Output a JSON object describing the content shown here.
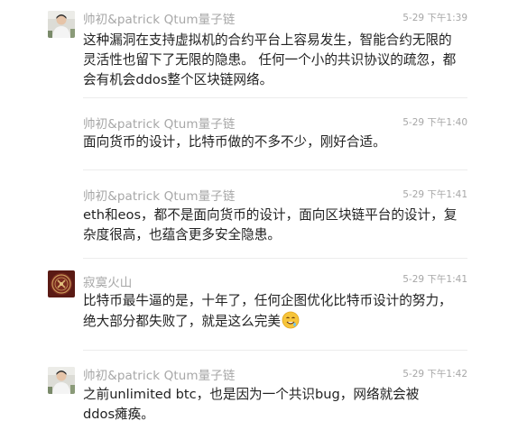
{
  "messages": [
    {
      "sender": "帅初&patrick Qtum量子链",
      "time": "5-29 下午1:39",
      "avatar": "person-photo",
      "lines": [
        "这种漏洞在支持虚拟机的合约平台上容易发生，智能合约无限的",
        "灵活性也留下了无限的隐患。 任何一个小的共识协议的疏忽，都",
        "会有机会ddos整个区块链网络。"
      ]
    },
    {
      "sender": "帅初&patrick Qtum量子链",
      "time": "5-29 下午1:40",
      "avatar": "none",
      "lines": [
        "面向货币的设计，比特币做的不多不少，刚好合适。"
      ]
    },
    {
      "sender": "帅初&patrick Qtum量子链",
      "time": "5-29 下午1:41",
      "avatar": "none",
      "lines": [
        "eth和eos，都不是面向货币的设计，面向区块链平台的设计，复",
        "杂度很高，也蕴含更多安全隐患。"
      ]
    },
    {
      "sender": "寂寞火山",
      "time": "5-29 下午1:41",
      "avatar": "emblem",
      "lines": [
        "比特币最牛逼的是，十年了，任何企图优化比特币设计的努力，",
        "绝大部分都失败了，就是这么完美"
      ],
      "emoji": "drooling-face-emoji"
    },
    {
      "sender": "帅初&patrick Qtum量子链",
      "time": "5-29 下午1:42",
      "avatar": "person-photo",
      "lines": [
        "之前unlimited btc，也是因为一个共识bug，网络就会被",
        "ddos瘫痪。"
      ]
    }
  ]
}
